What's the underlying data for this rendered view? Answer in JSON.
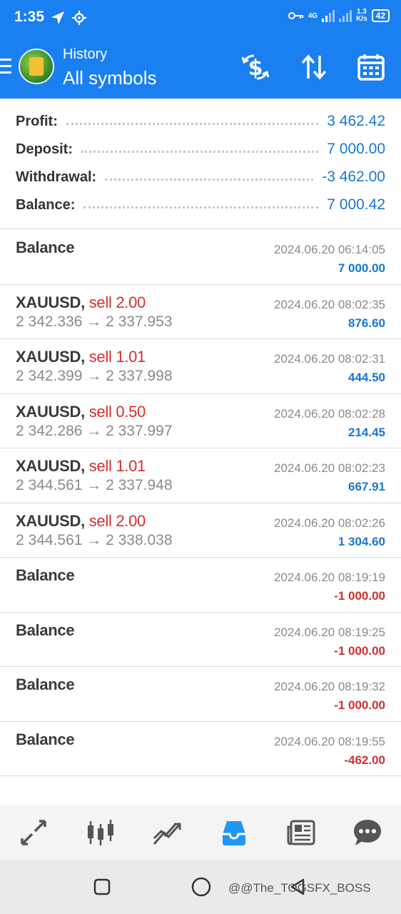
{
  "status": {
    "time": "1:35",
    "network": "4G",
    "speed_value": "1.3",
    "speed_unit": "K/s",
    "battery": "42"
  },
  "header": {
    "subtitle": "History",
    "title": "All symbols"
  },
  "summary": {
    "profit_label": "Profit:",
    "profit_value": "3 462.42",
    "deposit_label": "Deposit:",
    "deposit_value": "7 000.00",
    "withdrawal_label": "Withdrawal:",
    "withdrawal_value": "-3 462.00",
    "balance_label": "Balance:",
    "balance_value": "7 000.42"
  },
  "deals": [
    {
      "symbol": "Balance",
      "side": "",
      "prices": "",
      "time": "2024.06.20 06:14:05",
      "amount": "7 000.00",
      "sign": "pos"
    },
    {
      "symbol": "XAUUSD,",
      "side": "sell 2.00",
      "prices": "2 342.336 → 2 337.953",
      "time": "2024.06.20 08:02:35",
      "amount": "876.60",
      "sign": "pos"
    },
    {
      "symbol": "XAUUSD,",
      "side": "sell 1.01",
      "prices": "2 342.399 → 2 337.998",
      "time": "2024.06.20 08:02:31",
      "amount": "444.50",
      "sign": "pos"
    },
    {
      "symbol": "XAUUSD,",
      "side": "sell 0.50",
      "prices": "2 342.286 → 2 337.997",
      "time": "2024.06.20 08:02:28",
      "amount": "214.45",
      "sign": "pos"
    },
    {
      "symbol": "XAUUSD,",
      "side": "sell 1.01",
      "prices": "2 344.561 → 2 337.948",
      "time": "2024.06.20 08:02:23",
      "amount": "667.91",
      "sign": "pos"
    },
    {
      "symbol": "XAUUSD,",
      "side": "sell 2.00",
      "prices": "2 344.561 → 2 338.038",
      "time": "2024.06.20 08:02:26",
      "amount": "1 304.60",
      "sign": "pos"
    },
    {
      "symbol": "Balance",
      "side": "",
      "prices": "",
      "time": "2024.06.20 08:19:19",
      "amount": "-1 000.00",
      "sign": "neg"
    },
    {
      "symbol": "Balance",
      "side": "",
      "prices": "",
      "time": "2024.06.20 08:19:25",
      "amount": "-1 000.00",
      "sign": "neg"
    },
    {
      "symbol": "Balance",
      "side": "",
      "prices": "",
      "time": "2024.06.20 08:19:32",
      "amount": "-1 000.00",
      "sign": "neg"
    },
    {
      "symbol": "Balance",
      "side": "",
      "prices": "",
      "time": "2024.06.20 08:19:55",
      "amount": "-462.00",
      "sign": "neg"
    }
  ],
  "bottom_nav": [
    {
      "name": "quotes-icon",
      "active": false
    },
    {
      "name": "chart-candles-icon",
      "active": false
    },
    {
      "name": "trade-icon",
      "active": false
    },
    {
      "name": "history-inbox-icon",
      "active": true
    },
    {
      "name": "news-icon",
      "active": false
    },
    {
      "name": "chat-icon",
      "active": false
    }
  ],
  "watermark": "@@The_TOGSFX_BOSS",
  "colors": {
    "header_bg": "#1a7ff0",
    "positive": "#1976d2",
    "negative": "#d32f2f",
    "active_nav": "#2196f3",
    "inactive_nav": "#555555"
  }
}
